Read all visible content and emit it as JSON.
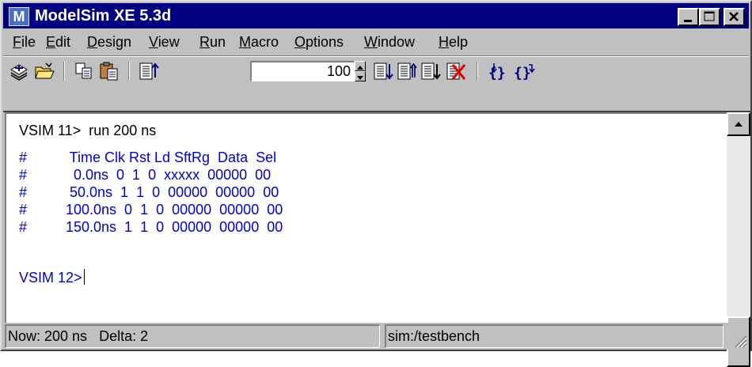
{
  "window": {
    "title": "ModelSim XE 5.3d",
    "app_icon": "modelsim-logo-icon",
    "caption_buttons": [
      "minimize-icon",
      "maximize-icon",
      "close-icon"
    ]
  },
  "menu": [
    {
      "label": "File",
      "accel": "F",
      "rest": "ile"
    },
    {
      "label": "Edit",
      "accel": "E",
      "rest": "dit"
    },
    {
      "label": "Design",
      "accel": "D",
      "rest": "esign"
    },
    {
      "label": "View",
      "accel": "V",
      "rest": "iew"
    },
    {
      "label": "Run",
      "accel": "R",
      "rest": "un"
    },
    {
      "label": "Macro",
      "accel": "M",
      "rest": "acro"
    },
    {
      "label": "Options",
      "accel": "O",
      "rest": "ptions"
    },
    {
      "label": "Window",
      "accel": "W",
      "rest": "indow"
    },
    {
      "label": "Help",
      "accel": "H",
      "rest": "elp"
    }
  ],
  "toolbar": {
    "icons": [
      "load-design-icon",
      "open-folder-icon",
      "copy-icon",
      "paste-icon",
      "run-restart-icon",
      "step-icon",
      "step-over-icon",
      "continue-icon",
      "break-icon",
      "step-into-brace-icon",
      "step-out-brace-icon"
    ],
    "run_length": "100"
  },
  "console": {
    "prompt1": "VSIM 11>",
    "command1": "run 200 ns",
    "output": [
      {
        "hash": "#",
        "text": "    Time Clk Rst Ld SftRg  Data  Sel"
      },
      {
        "hash": "#",
        "text": "     0.0ns  0  1  0  xxxxx  00000  00"
      },
      {
        "hash": "#",
        "text": "    50.0ns  1  1  0  00000  00000  00"
      },
      {
        "hash": "#",
        "text": "   100.0ns  0  1  0  00000  00000  00"
      },
      {
        "hash": "#",
        "text": "   150.0ns  1  1  0  00000  00000  00"
      }
    ],
    "prompt2": "VSIM 12>"
  },
  "status": {
    "now": "Now: 200 ns",
    "delta": "Delta: 2",
    "context": "sim:/testbench"
  }
}
